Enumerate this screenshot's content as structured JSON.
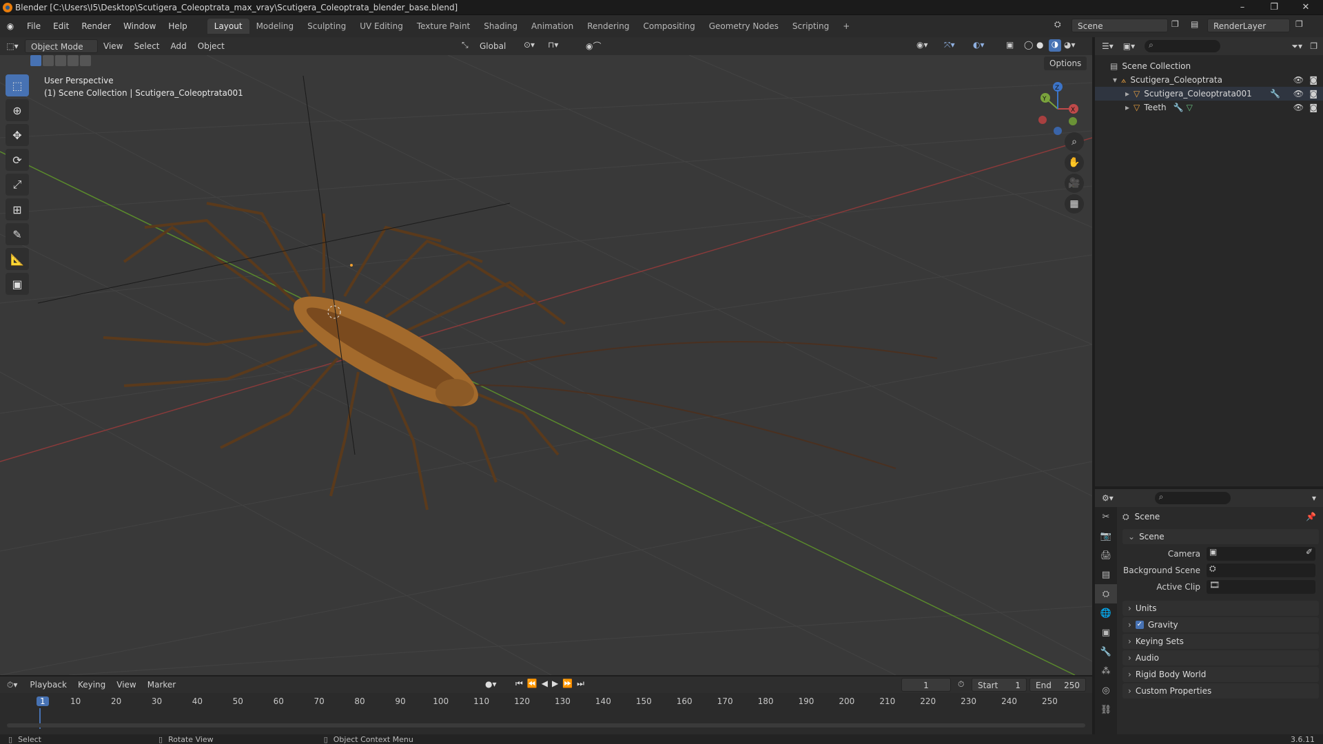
{
  "window": {
    "title": "Blender [C:\\Users\\I5\\Desktop\\Scutigera_Coleoptrata_max_vray\\Scutigera_Coleoptrata_blender_base.blend]",
    "minimize": "–",
    "restore": "❐",
    "close": "✕"
  },
  "menubar": {
    "menus": [
      "File",
      "Edit",
      "Render",
      "Window",
      "Help"
    ],
    "workspaces": [
      "Layout",
      "Modeling",
      "Sculpting",
      "UV Editing",
      "Texture Paint",
      "Shading",
      "Animation",
      "Rendering",
      "Compositing",
      "Geometry Nodes",
      "Scripting"
    ],
    "active_workspace": "Layout",
    "add_tab": "+",
    "scene_name": "Scene",
    "view_layer": "RenderLayer"
  },
  "viewport_header": {
    "mode": "Object Mode",
    "menus": [
      "View",
      "Select",
      "Add",
      "Object"
    ],
    "transform_orientation": "Global",
    "options": "Options"
  },
  "viewport": {
    "perspective_label": "User Perspective",
    "context_label": "(1) Scene Collection | Scutigera_Coleoptrata001",
    "gizmo_axes": [
      "X",
      "Y",
      "Z"
    ],
    "object": "Scutigera_Coleoptrata001"
  },
  "outliner": {
    "root": "Scene Collection",
    "items": [
      {
        "name": "Scutigera_Coleoptrata",
        "level": 1
      },
      {
        "name": "Scutigera_Coleoptrata001",
        "level": 2
      },
      {
        "name": "Teeth",
        "level": 2
      }
    ]
  },
  "properties": {
    "context": "Scene",
    "panel": "Scene",
    "fields": [
      {
        "label": "Camera",
        "value": ""
      },
      {
        "label": "Background Scene",
        "value": ""
      },
      {
        "label": "Active Clip",
        "value": ""
      }
    ],
    "collapsed_panels": [
      "Units",
      "Gravity",
      "Keying Sets",
      "Audio",
      "Rigid Body World",
      "Custom Properties"
    ],
    "gravity_checked": true
  },
  "timeline": {
    "menus": [
      "Playback",
      "Keying",
      "View",
      "Marker"
    ],
    "current_frame": "1",
    "start_label": "Start",
    "start": "1",
    "end_label": "End",
    "end": "250",
    "ruler": [
      "1",
      "10",
      "20",
      "30",
      "40",
      "50",
      "60",
      "70",
      "80",
      "90",
      "100",
      "110",
      "120",
      "130",
      "140",
      "150",
      "160",
      "170",
      "180",
      "190",
      "200",
      "210",
      "220",
      "230",
      "240",
      "250"
    ]
  },
  "statusbar": {
    "items": [
      "Select",
      "Rotate View",
      "Object Context Menu"
    ],
    "version": "3.6.11"
  },
  "colors": {
    "accent": "#4772b3",
    "x_axis": "#c04a4a",
    "y_axis": "#7aa33c",
    "z_axis": "#3c74c8",
    "object": "#b87a2e"
  }
}
